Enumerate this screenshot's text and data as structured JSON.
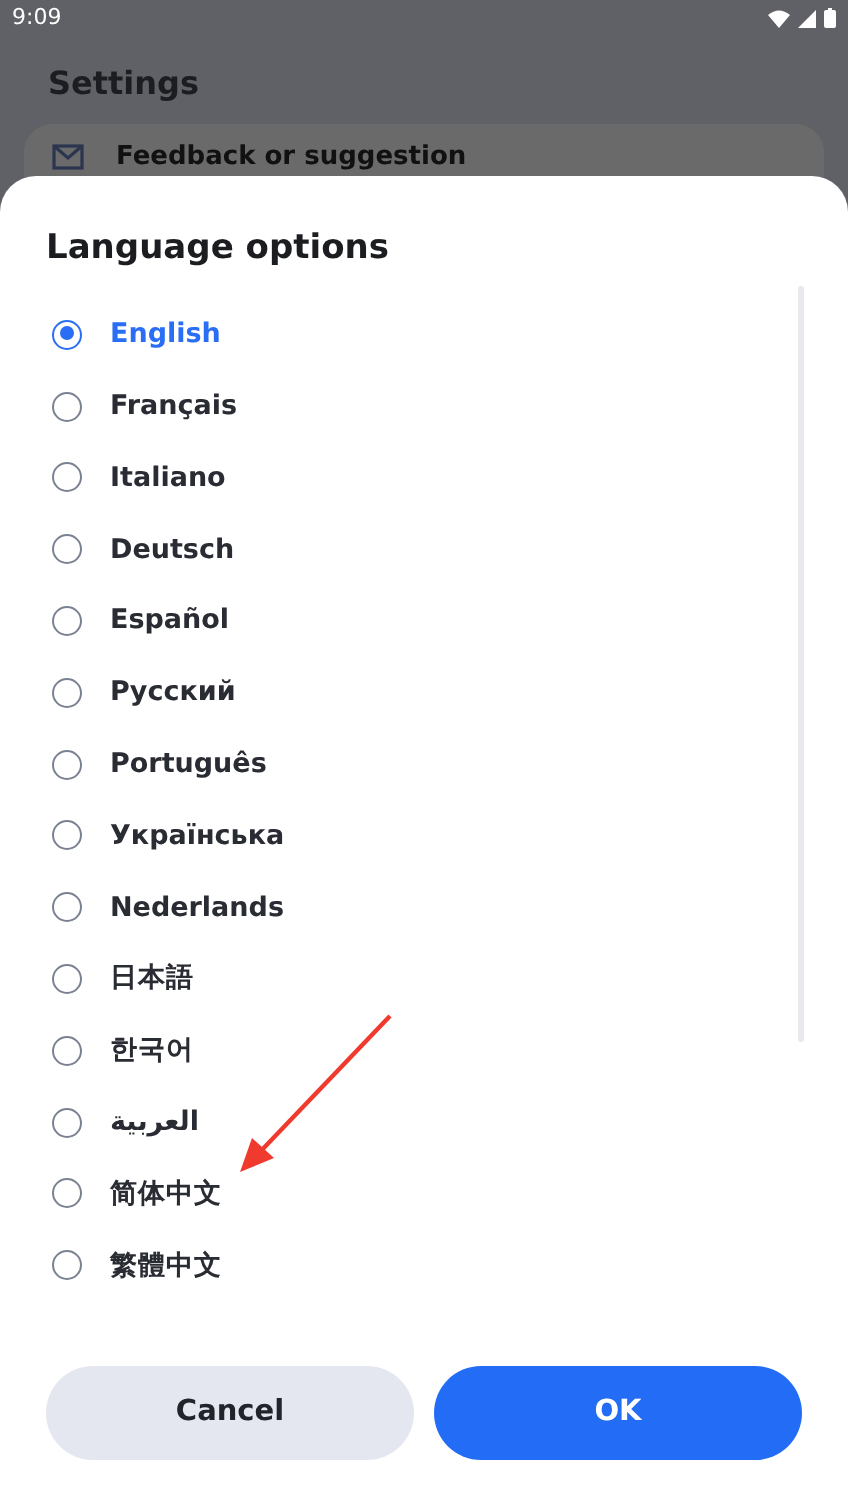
{
  "status_bar": {
    "time": "9:09"
  },
  "background": {
    "title": "Settings",
    "items": [
      {
        "label": "Feedback or suggestion"
      }
    ]
  },
  "dialog": {
    "title": "Language options",
    "options": [
      {
        "label": "English",
        "selected": true
      },
      {
        "label": "Français",
        "selected": false
      },
      {
        "label": "Italiano",
        "selected": false
      },
      {
        "label": "Deutsch",
        "selected": false
      },
      {
        "label": "Español",
        "selected": false
      },
      {
        "label": "Русский",
        "selected": false
      },
      {
        "label": "Português",
        "selected": false
      },
      {
        "label": "Українська",
        "selected": false
      },
      {
        "label": "Nederlands",
        "selected": false
      },
      {
        "label": "日本語",
        "selected": false
      },
      {
        "label": "한국어",
        "selected": false
      },
      {
        "label": "العربية",
        "selected": false
      },
      {
        "label": "简体中文",
        "selected": false
      },
      {
        "label": "繁體中文",
        "selected": false
      }
    ],
    "buttons": [
      {
        "label": "Cancel",
        "kind": "secondary"
      },
      {
        "label": "OK",
        "kind": "primary"
      }
    ]
  }
}
